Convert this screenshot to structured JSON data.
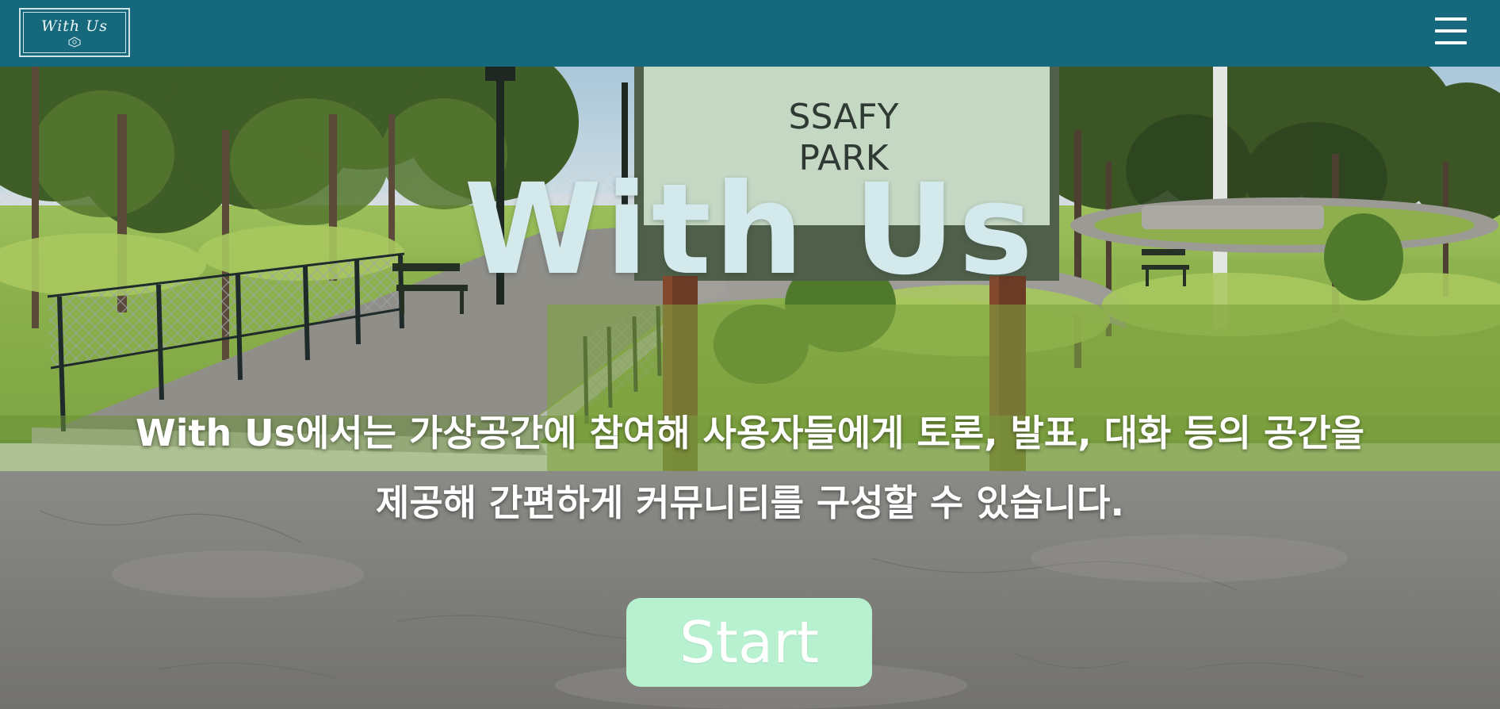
{
  "navbar": {
    "logo_text": "With Us",
    "logo_icon": "logo-emblem-icon",
    "menu_icon": "hamburger-menu-icon",
    "background_color": "#16697c"
  },
  "scene": {
    "sign_line1": "SSAFY",
    "sign_line2": "PARK"
  },
  "hero": {
    "title": "With Us",
    "description": "With Us에서는 가상공간에 참여해 사용자들에게 토론, 발표, 대화 등의 공간을 제공해 간편하게 커뮤니티를 구성할 수 있습니다.",
    "start_label": "Start",
    "start_color": "#b8f1d0"
  }
}
